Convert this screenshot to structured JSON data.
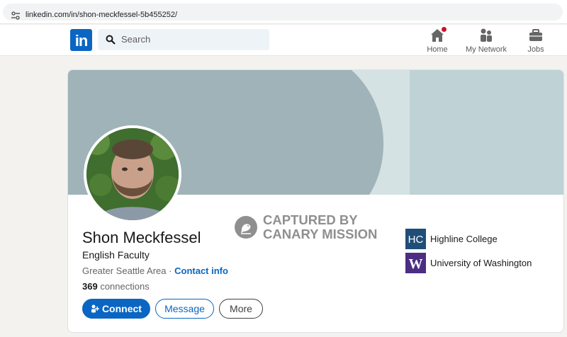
{
  "browser": {
    "url": "linkedin.com/in/shon-meckfessel-5b455252/"
  },
  "nav": {
    "logo_text": "in",
    "search_placeholder": "Search",
    "items": [
      {
        "label": "Home",
        "icon": "home-icon"
      },
      {
        "label": "My Network",
        "icon": "network-icon"
      },
      {
        "label": "Jobs",
        "icon": "briefcase-icon"
      }
    ]
  },
  "profile": {
    "name": "Shon Meckfessel",
    "headline": "English Faculty",
    "location": "Greater Seattle Area",
    "separator": "·",
    "contact_link": "Contact info",
    "connections_count": "369",
    "connections_label": "connections",
    "buttons": {
      "connect": "Connect",
      "message": "Message",
      "more": "More"
    },
    "education": [
      {
        "name": "Highline College",
        "logo_text": "HC",
        "logo_color": "#1f4e79"
      },
      {
        "name": "University of Washington",
        "logo_text": "W",
        "logo_color": "#4b2e83"
      }
    ]
  },
  "watermark": {
    "line1": "CAPTURED BY",
    "line2": "CANARY MISSION"
  },
  "colors": {
    "accent": "#0a66c2",
    "banner": "#bfd2d6",
    "notification": "#cb112d"
  }
}
